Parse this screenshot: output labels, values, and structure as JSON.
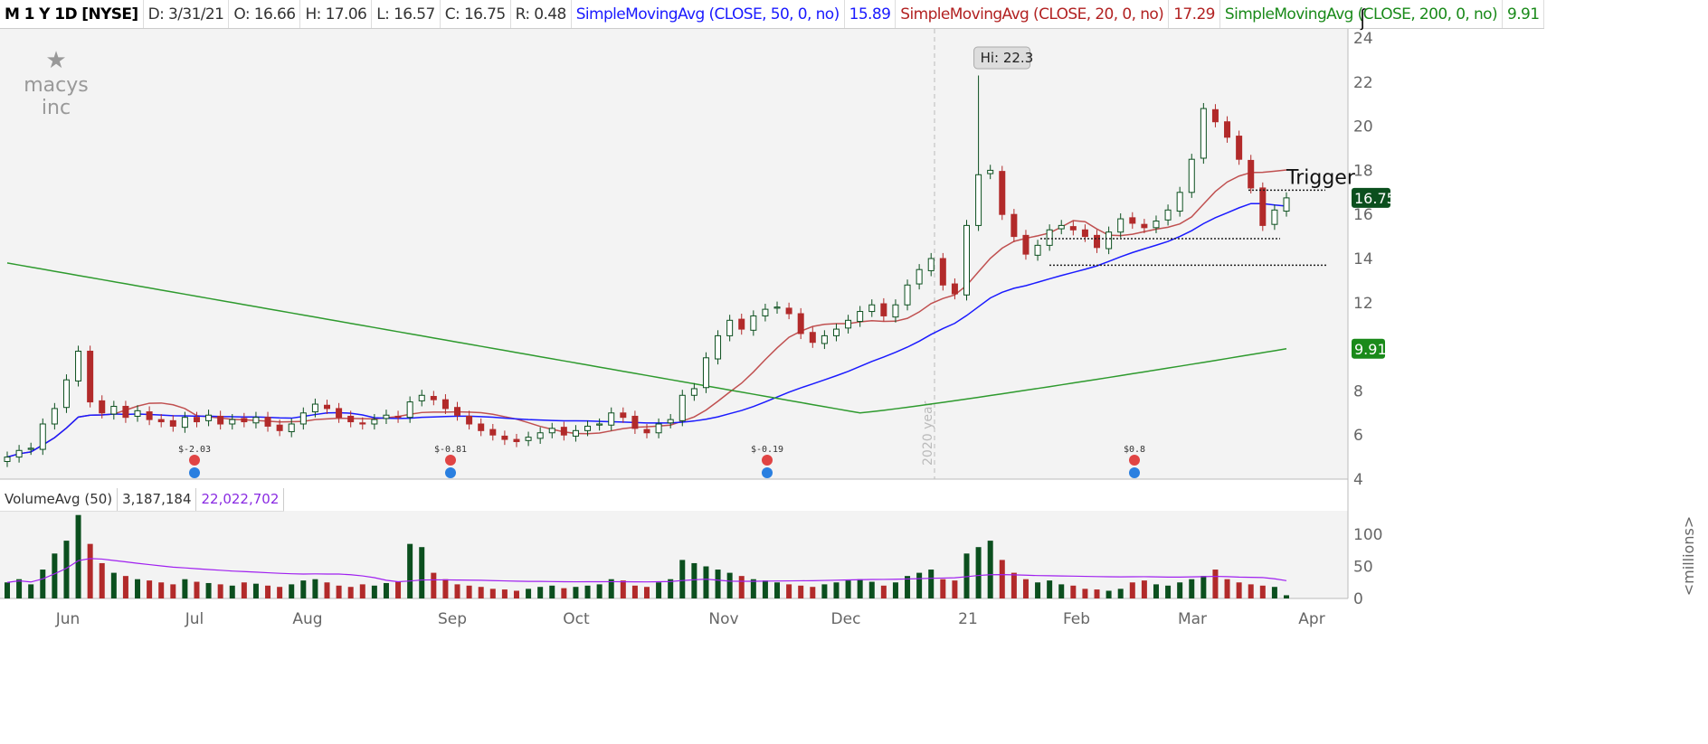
{
  "header": {
    "symbol": "M 1 Y 1D [NYSE]",
    "date": "D: 3/31/21",
    "open": "O: 16.66",
    "high": "H: 17.06",
    "low": "L: 16.57",
    "close": "C: 16.75",
    "range": "R: 0.48",
    "sma50_label": "SimpleMovingAvg (CLOSE, 50, 0, no)",
    "sma50_value": "15.89",
    "sma20_label": "SimpleMovingAvg (CLOSE, 20, 0, no)",
    "sma20_value": "17.29",
    "sma200_label": "SimpleMovingAvg (CLOSE, 200, 0, no)",
    "sma200_value": "9.91"
  },
  "logo": "macys inc",
  "volume_legend": {
    "label": "VolumeAvg (50)",
    "volume": "3,187,184",
    "avg": "22,022,702"
  },
  "colors": {
    "up": "#0b4f1e",
    "down": "#b22a2a",
    "sma50": "#1a1aff",
    "sma20": "#c05050",
    "sma200": "#2e9a2e",
    "volavg": "#a020f0"
  },
  "chart_data": {
    "type": "candlestick",
    "title": "M 1 Y 1D [NYSE]",
    "ylim": [
      4,
      24
    ],
    "yticks": [
      "4",
      "6",
      "8",
      "10",
      "12",
      "14",
      "16",
      "18",
      "20",
      "22",
      "24"
    ],
    "vol_ylim": [
      0,
      130
    ],
    "vol_ticks": [
      "0",
      "50",
      "100"
    ],
    "vol_unit": "<millions>",
    "xticks": [
      "Jun",
      "Jul",
      "Aug",
      "Sep",
      "Oct",
      "Nov",
      "Dec",
      "21",
      "Feb",
      "Mar",
      "Apr"
    ],
    "year_marker": "2020 year",
    "closes": [
      5.0,
      5.3,
      5.4,
      6.5,
      7.2,
      8.5,
      9.8,
      7.5,
      7.0,
      7.3,
      6.8,
      7.1,
      6.7,
      6.6,
      6.4,
      6.8,
      6.6,
      6.9,
      6.5,
      6.7,
      6.6,
      6.8,
      6.4,
      6.2,
      6.5,
      7.0,
      7.4,
      7.2,
      6.8,
      6.6,
      6.5,
      6.7,
      6.9,
      6.8,
      7.5,
      7.8,
      7.6,
      7.2,
      6.9,
      6.5,
      6.2,
      6.0,
      5.8,
      5.7,
      5.9,
      6.1,
      6.3,
      6.0,
      6.2,
      6.4,
      6.5,
      7.0,
      6.8,
      6.3,
      6.1,
      6.5,
      6.7,
      7.8,
      8.1,
      9.5,
      10.5,
      11.2,
      10.8,
      11.4,
      11.7,
      11.8,
      11.5,
      10.6,
      10.2,
      10.5,
      10.8,
      11.2,
      11.6,
      11.9,
      11.4,
      11.9,
      12.8,
      13.5,
      14.0,
      12.8,
      12.4,
      15.5,
      17.8,
      18.0,
      16.0,
      15.0,
      14.2,
      14.6,
      15.3,
      15.5,
      15.3,
      15.0,
      14.5,
      15.2,
      15.8,
      15.6,
      15.4,
      15.7,
      16.2,
      17.0,
      18.5,
      20.8,
      20.2,
      19.5,
      18.5,
      17.2,
      15.5,
      16.2,
      16.75
    ],
    "volumes": [
      25,
      30,
      22,
      45,
      70,
      90,
      130,
      85,
      55,
      40,
      35,
      30,
      28,
      25,
      22,
      30,
      26,
      24,
      22,
      20,
      25,
      23,
      20,
      18,
      22,
      28,
      30,
      25,
      20,
      18,
      22,
      20,
      24,
      26,
      85,
      80,
      40,
      30,
      22,
      20,
      18,
      15,
      14,
      12,
      15,
      18,
      20,
      16,
      18,
      20,
      22,
      30,
      28,
      20,
      18,
      25,
      30,
      60,
      55,
      50,
      45,
      40,
      35,
      30,
      28,
      25,
      22,
      20,
      18,
      22,
      25,
      28,
      30,
      26,
      20,
      25,
      35,
      40,
      45,
      30,
      28,
      70,
      80,
      90,
      60,
      40,
      30,
      25,
      28,
      22,
      20,
      15,
      14,
      12,
      15,
      25,
      28,
      22,
      20,
      25,
      30,
      35,
      45,
      30,
      25,
      22,
      20,
      18,
      5
    ],
    "highlight": {
      "label": "Hi: 22.3",
      "value": 22.3,
      "index": 82
    },
    "earnings": [
      {
        "index": 31,
        "label": "$-2.03"
      },
      {
        "index": 66,
        "label": "$-0.81"
      },
      {
        "index": 62,
        "label": "$-0.19"
      },
      {
        "index": 92,
        "label": "$0.8"
      }
    ],
    "annotation": {
      "label": "Trigger",
      "value": 17.1
    },
    "levels": [
      17.1,
      14.9,
      13.7
    ],
    "last_price": "16.75",
    "sma200_last": "9.91"
  }
}
